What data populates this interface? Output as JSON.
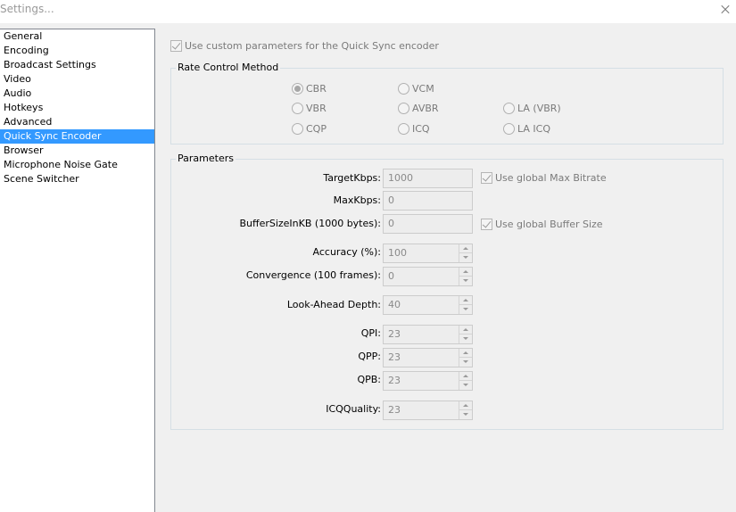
{
  "window": {
    "title": "Settings..."
  },
  "sidebar": {
    "items": [
      {
        "label": "General"
      },
      {
        "label": "Encoding"
      },
      {
        "label": "Broadcast Settings"
      },
      {
        "label": "Video"
      },
      {
        "label": "Audio"
      },
      {
        "label": "Hotkeys"
      },
      {
        "label": "Advanced"
      },
      {
        "label": "Quick Sync Encoder",
        "selected": true
      },
      {
        "label": "Browser"
      },
      {
        "label": "Microphone Noise Gate"
      },
      {
        "label": "Scene Switcher"
      }
    ]
  },
  "custom_params": {
    "label": "Use custom parameters for the Quick Sync encoder",
    "checked": true
  },
  "rate_control": {
    "title": "Rate Control Method",
    "options": [
      {
        "label": "CBR",
        "checked": true
      },
      {
        "label": "VCM",
        "checked": false
      },
      {
        "label": "VBR",
        "checked": false
      },
      {
        "label": "AVBR",
        "checked": false
      },
      {
        "label": "LA (VBR)",
        "checked": false
      },
      {
        "label": "CQP",
        "checked": false
      },
      {
        "label": "ICQ",
        "checked": false
      },
      {
        "label": "LA ICQ",
        "checked": false
      }
    ]
  },
  "parameters": {
    "title": "Parameters",
    "target_kbps": {
      "label": "TargetKbps:",
      "value": "1000"
    },
    "max_kbps": {
      "label": "MaxKbps:",
      "value": "0"
    },
    "buffer_size": {
      "label": "BufferSizeInKB (1000 bytes):",
      "value": "0"
    },
    "use_global_max_bitrate": {
      "label": "Use global Max Bitrate",
      "checked": true
    },
    "use_global_buffer_size": {
      "label": "Use global Buffer Size",
      "checked": true
    },
    "accuracy": {
      "label": "Accuracy (%):",
      "value": "100"
    },
    "convergence": {
      "label": "Convergence (100 frames):",
      "value": "0"
    },
    "look_ahead": {
      "label": "Look-Ahead Depth:",
      "value": "40"
    },
    "qpi": {
      "label": "QPI:",
      "value": "23"
    },
    "qpp": {
      "label": "QPP:",
      "value": "23"
    },
    "qpb": {
      "label": "QPB:",
      "value": "23"
    },
    "icq_quality": {
      "label": "ICQQuality:",
      "value": "23"
    }
  },
  "colors": {
    "selection": "#3399ff",
    "disabled_text": "#7a7a7a"
  }
}
